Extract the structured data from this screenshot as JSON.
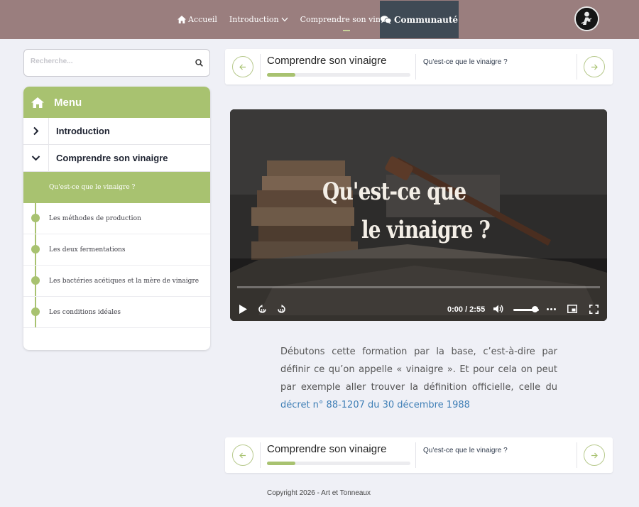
{
  "header": {
    "nav": [
      {
        "label": "Accueil",
        "icon": "home-icon"
      },
      {
        "label": "Introduction",
        "icon": "chevron-down-icon"
      },
      {
        "label": "Comprendre son vinaigre",
        "icon": "chevron-down-icon",
        "active": true
      }
    ],
    "community_label": "Communauté",
    "community_icon": "chat-bubbles-icon",
    "avatar": "user-avatar"
  },
  "sidebar": {
    "search_placeholder": "Recherche...",
    "menu_title": "Menu",
    "sections": [
      {
        "label": "Introduction",
        "expanded": false
      },
      {
        "label": "Comprendre son vinaigre",
        "expanded": true
      }
    ],
    "active_lesson": "Qu'est-ce que le vinaigre ?",
    "lessons": [
      "Les méthodes de production",
      "Les deux fermentations",
      "Les bactéries acétiques et la mère de vinaigre",
      "Les conditions idéales"
    ]
  },
  "lesson_nav": {
    "section_title": "Comprendre son vinaigre",
    "progress_fraction": 0.2,
    "next_lesson": "Qu'est-ce que le vinaigre ?",
    "prev_icon": "arrow-left-icon",
    "next_icon": "arrow-right-icon"
  },
  "video": {
    "title_line1": "Qu'est-ce que",
    "title_line2": "le vinaigre ?",
    "time": "0:00 / 2:55",
    "volume_fraction": 0.85
  },
  "content": {
    "paragraph": "Débutons cette formation par la base, c’est-à-dire par définir ce qu’on appelle « vinaigre ». Et pour cela on peut par exemple aller trouver la définition officielle, celle du",
    "link": "décret n° 88-1207 du 30 décembre 1988"
  },
  "footer": {
    "copyright": "Copyright 2026 - Art et Tonneaux"
  },
  "colors": {
    "topbar": "#9a7e7e",
    "accent_green": "#a8c270",
    "community_bg": "#3f4a55",
    "link": "#3f7fb6"
  }
}
